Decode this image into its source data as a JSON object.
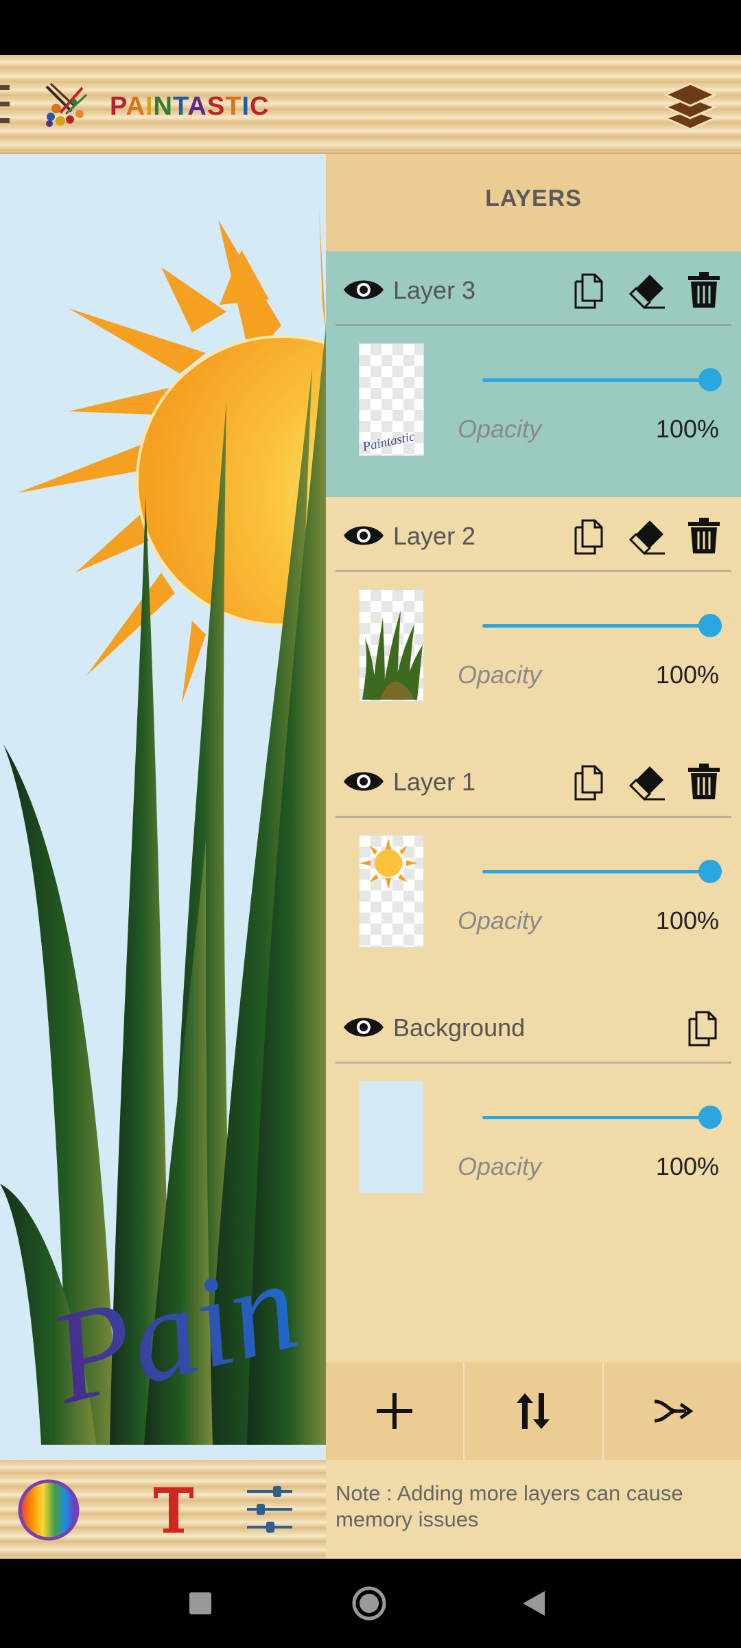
{
  "app": {
    "title_letters": [
      {
        "char": "P",
        "color": "#b8232a"
      },
      {
        "char": "A",
        "color": "#d8731c"
      },
      {
        "char": "I",
        "color": "#d4a214"
      },
      {
        "char": "N",
        "color": "#2e7d32"
      },
      {
        "char": "T",
        "color": "#1f5da6"
      },
      {
        "char": "A",
        "color": "#5b2c86"
      },
      {
        "char": "S",
        "color": "#b8232a"
      },
      {
        "char": "T",
        "color": "#d8731c"
      },
      {
        "char": "I",
        "color": "#1f5da6"
      },
      {
        "char": "C",
        "color": "#b8232a"
      }
    ]
  },
  "canvas": {
    "text_snippet": "Pain"
  },
  "panel": {
    "title": "LAYERS"
  },
  "layers": [
    {
      "name": "Layer 3",
      "opacity_label": "Opacity",
      "opacity_value": "100%",
      "opacity": 1.0,
      "selected": true,
      "thumb_text": "Paintastic"
    },
    {
      "name": "Layer 2",
      "opacity_label": "Opacity",
      "opacity_value": "100%",
      "opacity": 1.0,
      "selected": false
    },
    {
      "name": "Layer 1",
      "opacity_label": "Opacity",
      "opacity_value": "100%",
      "opacity": 1.0,
      "selected": false
    },
    {
      "name": "Background",
      "opacity_label": "Opacity",
      "opacity_value": "100%",
      "opacity": 1.0,
      "selected": false
    }
  ],
  "panel_actions": [
    "add-layer",
    "reorder-layers",
    "merge-layers"
  ],
  "note": "Note : Adding more layers can cause memory issues",
  "colors": {
    "accent": "#2aa7e1",
    "selected_row": "#9bcac1",
    "panel_bg": "#f0dba8",
    "text_tool": "#d0261f"
  },
  "icons": {
    "app_bar": [
      "menu-icon",
      "paintastic-logo",
      "layers-stack-icon"
    ],
    "row_actions": [
      "duplicate-icon",
      "eraser-icon",
      "trash-icon"
    ],
    "toolbar": [
      "color-wheel-icon",
      "text-tool-icon",
      "adjustments-icon"
    ],
    "nav": [
      "recents-icon",
      "home-icon",
      "back-icon"
    ]
  }
}
